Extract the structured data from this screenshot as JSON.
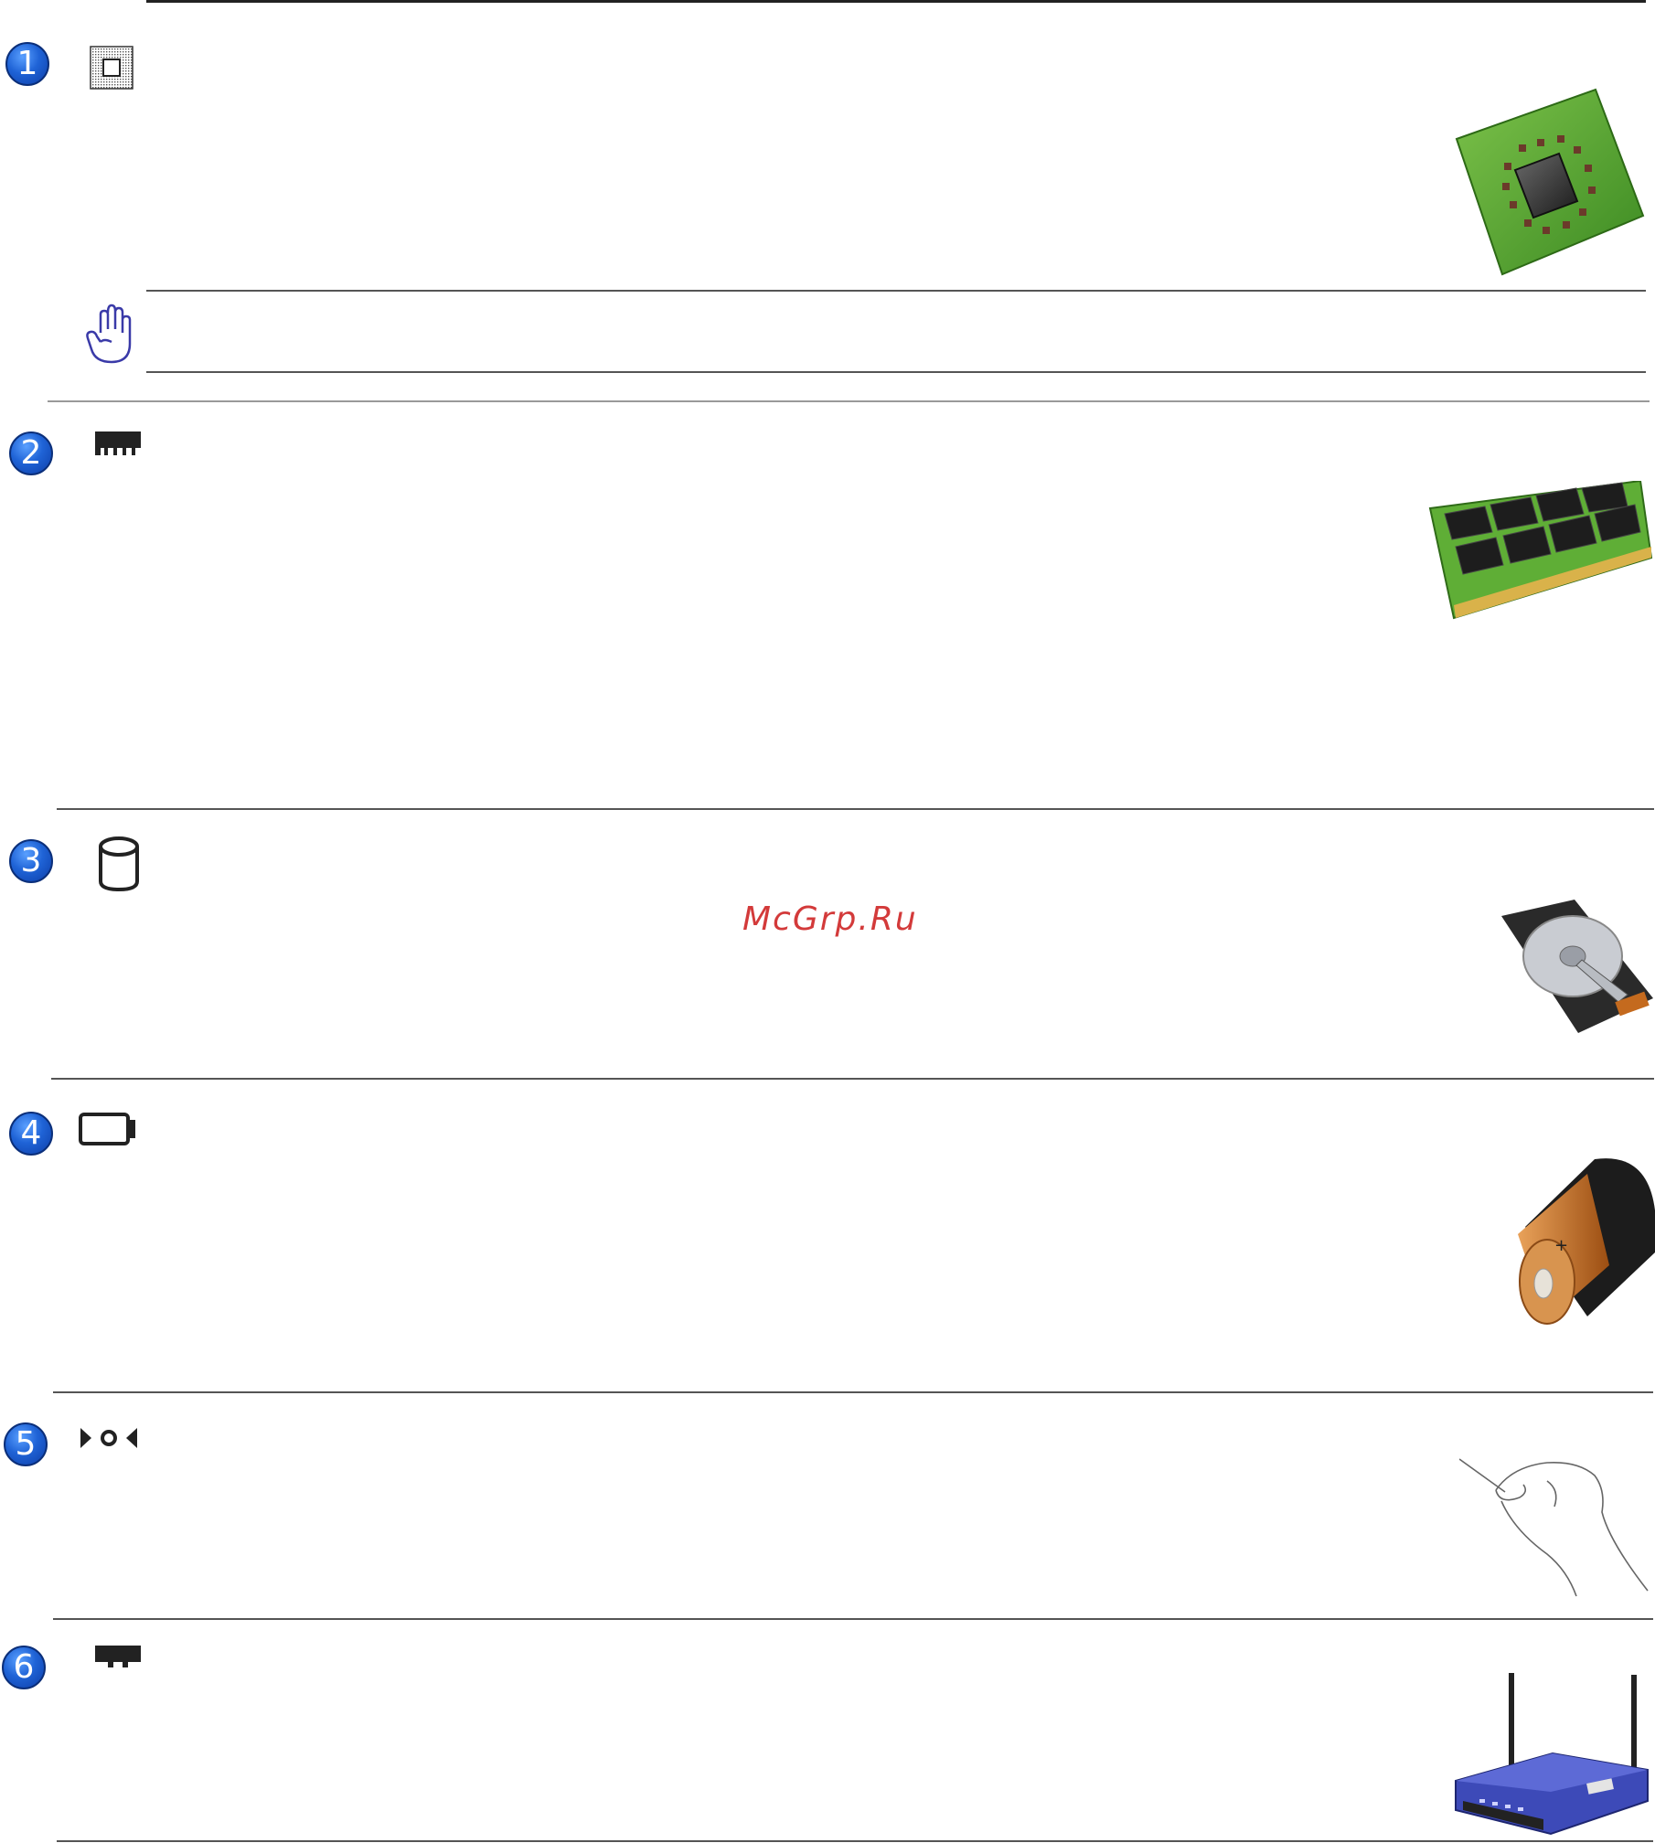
{
  "sections": [
    {
      "number": "1",
      "icon": "cpu-icon",
      "photo": "cpu-chip-photo"
    },
    {
      "number": "2",
      "icon": "memory-icon",
      "photo": "ram-module-photo"
    },
    {
      "number": "3",
      "icon": "hard-disk-icon",
      "photo": "hard-drive-photo"
    },
    {
      "number": "4",
      "icon": "battery-icon",
      "photo": "battery-photo"
    },
    {
      "number": "5",
      "icon": "reset-icon",
      "photo": "pin-reset-hand-photo"
    },
    {
      "number": "6",
      "icon": "wireless-card-icon",
      "photo": "wireless-router-photo"
    }
  ],
  "warning": {
    "icon": "raised-hand-warning-icon"
  },
  "watermark": {
    "text": "McGrp.Ru"
  },
  "colors": {
    "badge": "#1f63d6",
    "warning_icon": "#3a3aa8",
    "watermark": "#d33a3a"
  }
}
